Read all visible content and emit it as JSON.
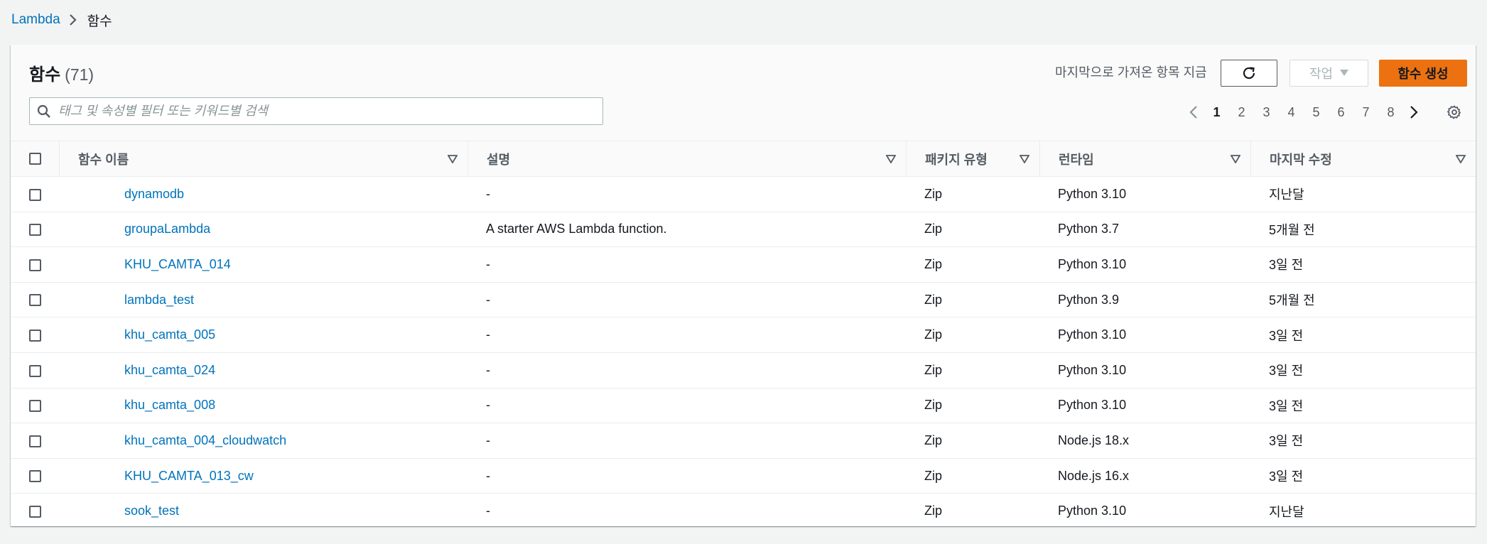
{
  "breadcrumb": {
    "root": "Lambda",
    "current": "함수"
  },
  "header": {
    "title": "함수",
    "count": "(71)",
    "last_fetched": "마지막으로 가져온 항목 지금",
    "actions_label": "작업",
    "create_label": "함수 생성"
  },
  "search": {
    "placeholder": "태그 및 속성별 필터 또는 키워드별 검색",
    "value": ""
  },
  "pagination": {
    "pages": [
      "1",
      "2",
      "3",
      "4",
      "5",
      "6",
      "7",
      "8"
    ],
    "current": "1"
  },
  "table": {
    "columns": [
      "함수 이름",
      "설명",
      "패키지 유형",
      "런타임",
      "마지막 수정"
    ],
    "rows": [
      {
        "name": "dynamodb",
        "desc": "-",
        "pkg": "Zip",
        "runtime": "Python 3.10",
        "modified": "지난달"
      },
      {
        "name": "groupaLambda",
        "desc": "A starter AWS Lambda function.",
        "pkg": "Zip",
        "runtime": "Python 3.7",
        "modified": "5개월 전"
      },
      {
        "name": "KHU_CAMTA_014",
        "desc": "-",
        "pkg": "Zip",
        "runtime": "Python 3.10",
        "modified": "3일 전"
      },
      {
        "name": "lambda_test",
        "desc": "-",
        "pkg": "Zip",
        "runtime": "Python 3.9",
        "modified": "5개월 전"
      },
      {
        "name": "khu_camta_005",
        "desc": "-",
        "pkg": "Zip",
        "runtime": "Python 3.10",
        "modified": "3일 전"
      },
      {
        "name": "khu_camta_024",
        "desc": "-",
        "pkg": "Zip",
        "runtime": "Python 3.10",
        "modified": "3일 전"
      },
      {
        "name": "khu_camta_008",
        "desc": "-",
        "pkg": "Zip",
        "runtime": "Python 3.10",
        "modified": "3일 전"
      },
      {
        "name": "khu_camta_004_cloudwatch",
        "desc": "-",
        "pkg": "Zip",
        "runtime": "Node.js 18.x",
        "modified": "3일 전"
      },
      {
        "name": "KHU_CAMTA_013_cw",
        "desc": "-",
        "pkg": "Zip",
        "runtime": "Node.js 16.x",
        "modified": "3일 전"
      },
      {
        "name": "sook_test",
        "desc": "-",
        "pkg": "Zip",
        "runtime": "Python 3.10",
        "modified": "지난달"
      }
    ]
  },
  "colors": {
    "link": "#0073bb",
    "primary_button": "#ec7211",
    "background": "#f2f3f3"
  },
  "icons": {
    "breadcrumb_separator": "chevron-right-icon",
    "refresh": "refresh-icon",
    "actions_caret": "caret-down-icon",
    "search": "search-icon",
    "prev": "chevron-left-icon",
    "next": "chevron-right-icon",
    "settings": "gear-icon",
    "sort": "sort-caret-icon"
  }
}
